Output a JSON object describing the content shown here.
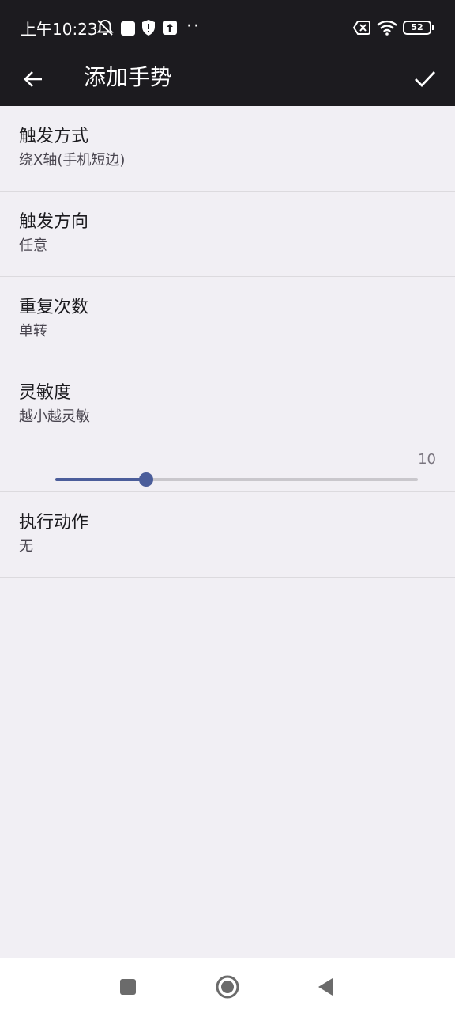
{
  "status_bar": {
    "time": "上午10:23",
    "icons": [
      "mute-notifications-icon",
      "square-notification-icon",
      "shield-alert-icon",
      "upload-icon",
      "more-notifications-dots",
      "no-sim-icon",
      "wifi-icon",
      "battery-icon"
    ],
    "dots": "··",
    "battery_level": "52"
  },
  "app_bar": {
    "back_icon": "arrow-back-icon",
    "title": "添加手势",
    "confirm_icon": "checkmark-icon"
  },
  "settings": {
    "trigger_mode": {
      "title": "触发方式",
      "value": "绕X轴(手机短边)"
    },
    "trigger_direction": {
      "title": "触发方向",
      "value": "任意"
    },
    "repeat_count": {
      "title": "重复次数",
      "value": "单转"
    },
    "sensitivity": {
      "title": "灵敏度",
      "description": "越小越灵敏",
      "value_label": "10",
      "slider_fraction": 0.25
    },
    "action": {
      "title": "执行动作",
      "value": "无"
    }
  },
  "colors": {
    "bar_background": "#1c1b1f",
    "page_background": "#f1eff4",
    "accent": "#4b5d9a",
    "divider": "#dcdade"
  },
  "nav_bar": {
    "icons": [
      "recents-square-icon",
      "home-circle-icon",
      "back-triangle-icon"
    ]
  }
}
